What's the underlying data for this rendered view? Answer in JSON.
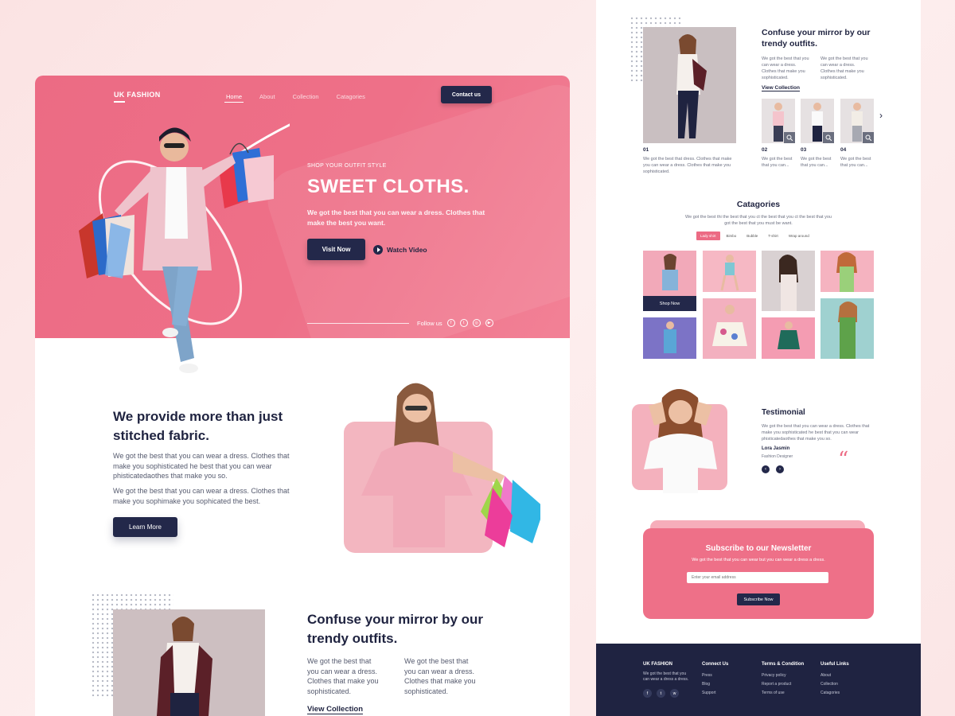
{
  "left": {
    "header": {
      "logo": "UK FASHION",
      "nav": [
        "Home",
        "About",
        "Collection",
        "Catagories"
      ],
      "contact_label": "Contact us"
    },
    "hero": {
      "eyebrow": "SHOP YOUR OUTFIT STYLE",
      "title": "SWEET CLOTHS.",
      "subtitle": "We got the best that you can wear a dress. Clothes that make the best you want.",
      "visit_label": "Visit Now",
      "watch_label": "Watch Video",
      "follow_label": "Follow us",
      "social_icons": [
        "facebook-icon",
        "twitter-icon",
        "instagram-icon",
        "youtube-icon"
      ]
    },
    "about": {
      "title": "We provide more than just stitched fabric.",
      "para1": "We got the best that you can wear a dress. Clothes that make you sophisticated he best that you can wear phisticatedaothes that make you so.",
      "para2": "We got the best that you can wear a dress. Clothes that make you sophimake you sophicated the best.",
      "button": "Learn More"
    },
    "outfits": {
      "title": "Confuse your mirror by our trendy outfits.",
      "col1": "We got the best that you can wear a dress. Clothes that make you sophisticated.",
      "col2": "We got the best that you can wear a dress. Clothes that make you sophisticated.",
      "link": "View Collection"
    }
  },
  "right": {
    "outfits": {
      "title": "Confuse your mirror by our trendy outfits.",
      "col1": "We got the best that you can wear a dress. Clothes that make you sophisticated.",
      "col2": "We got the best that you can wear a dress. Clothes that make you sophisticated.",
      "link": "View Collection",
      "main_num": "01",
      "main_desc": "We got the best that dress. Clothes that make you can wear a dress. Clothes that make you sophisticated.",
      "thumbs": [
        {
          "num": "02",
          "desc": "We got the best that you can..."
        },
        {
          "num": "03",
          "desc": "We got the best that you can..."
        },
        {
          "num": "04",
          "desc": "We got the best that you can..."
        }
      ]
    },
    "categories": {
      "title": "Catagories",
      "desc": "We got the best thi the best that you ct the best that you ct the best that you got the best that you must be want.",
      "tabs": [
        "Lady shirt",
        "Bimbo",
        "Bubble",
        "T-shirt",
        "Wrap around"
      ],
      "shop_now": "Shop Now"
    },
    "testimonial": {
      "title": "Testimonial",
      "text": "We got the best that you can wear a dress. Clothes that make you sophisticated he best that you can wear phisticatedaothes that make you so.",
      "name": "Lora Jasmin",
      "role": "Fashion Designer"
    },
    "newsletter": {
      "title": "Subscribe to our Newsletter",
      "subtitle": "We got the best that you can wear but you can wear a dress a dress.",
      "placeholder": "Enter your email address",
      "button": "Subscribe Now"
    },
    "footer": {
      "logo": "UK FASHION",
      "desc": "We got the best that you can wear a dress a dress.",
      "connect": {
        "title": "Connect Us",
        "items": [
          "Press",
          "Blog",
          "Support"
        ]
      },
      "terms": {
        "title": "Terms & Condition",
        "items": [
          "Privacy policy",
          "Report a product",
          "Terms of use"
        ]
      },
      "useful": {
        "title": "Useful Links",
        "items": [
          "About",
          "Collection",
          "Catagories"
        ]
      }
    }
  },
  "colors": {
    "pink": "#ec6b84",
    "navy": "#23284a",
    "blush": "#fbe3e3"
  }
}
